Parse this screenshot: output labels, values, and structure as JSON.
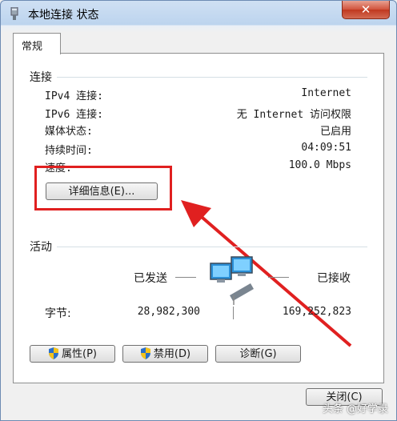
{
  "window": {
    "title": "本地连接 状态",
    "close_glyph": "✕"
  },
  "tab": {
    "label": "常规"
  },
  "connection": {
    "heading": "连接",
    "rows": [
      {
        "label": "IPv4 连接:",
        "value": "Internet"
      },
      {
        "label": "IPv6 连接:",
        "value": "无 Internet 访问权限"
      },
      {
        "label": "媒体状态:",
        "value": "已启用"
      },
      {
        "label": "持续时间:",
        "value": "04:09:51"
      },
      {
        "label": "速度:",
        "value": "100.0 Mbps"
      }
    ],
    "details_button": "详细信息(E)..."
  },
  "activity": {
    "heading": "活动",
    "sent_label": "已发送",
    "received_label": "已接收",
    "bytes_label": "字节:",
    "bytes_sent": "28,982,300",
    "bytes_received": "169,252,823"
  },
  "buttons": {
    "properties": "属性(P)",
    "disable": "禁用(D)",
    "diagnose": "诊断(G)",
    "close": "关闭(C)"
  },
  "watermark": "头条 @好学录"
}
